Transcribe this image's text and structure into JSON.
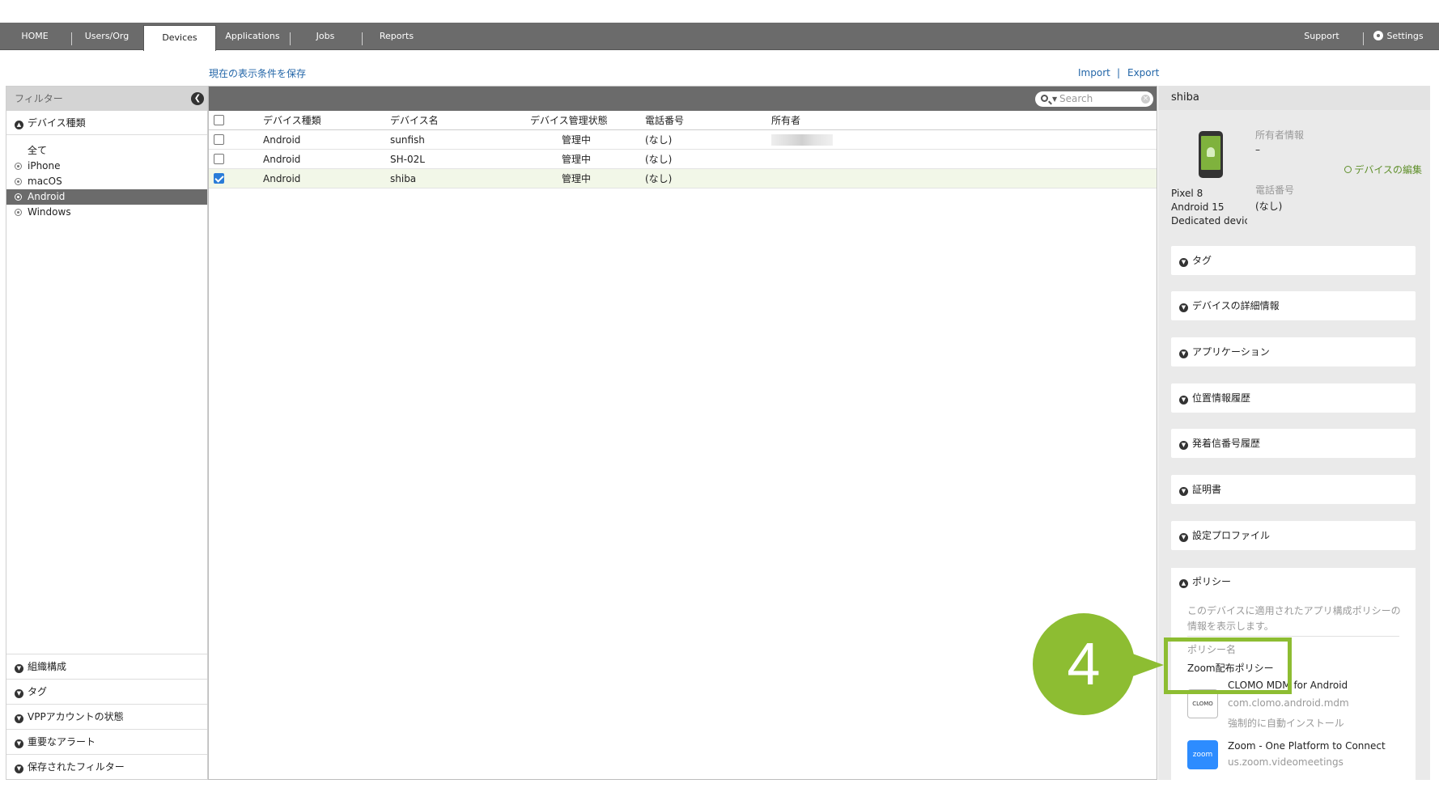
{
  "nav": {
    "home": "HOME",
    "users_org": "Users/Org",
    "devices": "Devices",
    "applications": "Applications",
    "jobs": "Jobs",
    "reports": "Reports",
    "support": "Support",
    "settings": "Settings"
  },
  "links": {
    "save_view": "現在の表示条件を保存",
    "import": "Import",
    "separator": "|",
    "export": "Export"
  },
  "filter": {
    "title": "フィルター",
    "device_type_label": "デバイス種類",
    "items": [
      {
        "label": "全て",
        "radio": false,
        "active": false
      },
      {
        "label": "iPhone",
        "radio": true,
        "active": false
      },
      {
        "label": "macOS",
        "radio": true,
        "active": false
      },
      {
        "label": "Android",
        "radio": true,
        "active": true
      },
      {
        "label": "Windows",
        "radio": true,
        "active": false
      }
    ],
    "bottom_sections": [
      "組織構成",
      "タグ",
      "VPPアカウントの状態",
      "重要なアラート",
      "保存されたフィルター"
    ]
  },
  "search": {
    "placeholder": "Search"
  },
  "table": {
    "headers": [
      "デバイス種類",
      "デバイス名",
      "デバイス管理状態",
      "電話番号",
      "所有者"
    ],
    "rows": [
      {
        "type": "Android",
        "name": "sunfish",
        "status": "管理中",
        "phone": "(なし)",
        "checked": false,
        "owner_blurred": true
      },
      {
        "type": "Android",
        "name": "SH-02L",
        "status": "管理中",
        "phone": "(なし)",
        "checked": false,
        "owner_blurred": false
      },
      {
        "type": "Android",
        "name": "shiba",
        "status": "管理中",
        "phone": "(なし)",
        "checked": true,
        "owner_blurred": false
      }
    ]
  },
  "detail": {
    "title": "shiba",
    "model": "Pixel 8",
    "os": "Android 15",
    "mode": "Dedicated device",
    "owner_label": "所有者情報",
    "owner_value": "–",
    "phone_label": "電話番号",
    "phone_value": "(なし)",
    "edit_label": "デバイスの編集",
    "sections": [
      "タグ",
      "デバイスの詳細情報",
      "アプリケーション",
      "位置情報履歴",
      "発着信番号履歴",
      "証明書",
      "設定プロファイル"
    ],
    "policy": {
      "title": "ポリシー",
      "description": "このデバイスに適用されたアプリ構成ポリシーの情報を表示します。",
      "name_label": "ポリシー名",
      "name_value": "Zoom配布ポリシー",
      "apps": [
        {
          "name": "CLOMO MDM for Android",
          "package": "com.clomo.android.mdm",
          "install": "強制的に自動インストール",
          "icon_text": "CLOMO"
        },
        {
          "name": "Zoom - One Platform to Connect",
          "package": "us.zoom.videomeetings",
          "install": "",
          "icon_text": "zoom"
        }
      ]
    }
  },
  "callout": {
    "number": "4"
  },
  "colors": {
    "nav_bg": "#6b6b6b",
    "link": "#2366a8",
    "accent_green": "#8dbd32",
    "checkbox_blue": "#2a7cd8"
  }
}
